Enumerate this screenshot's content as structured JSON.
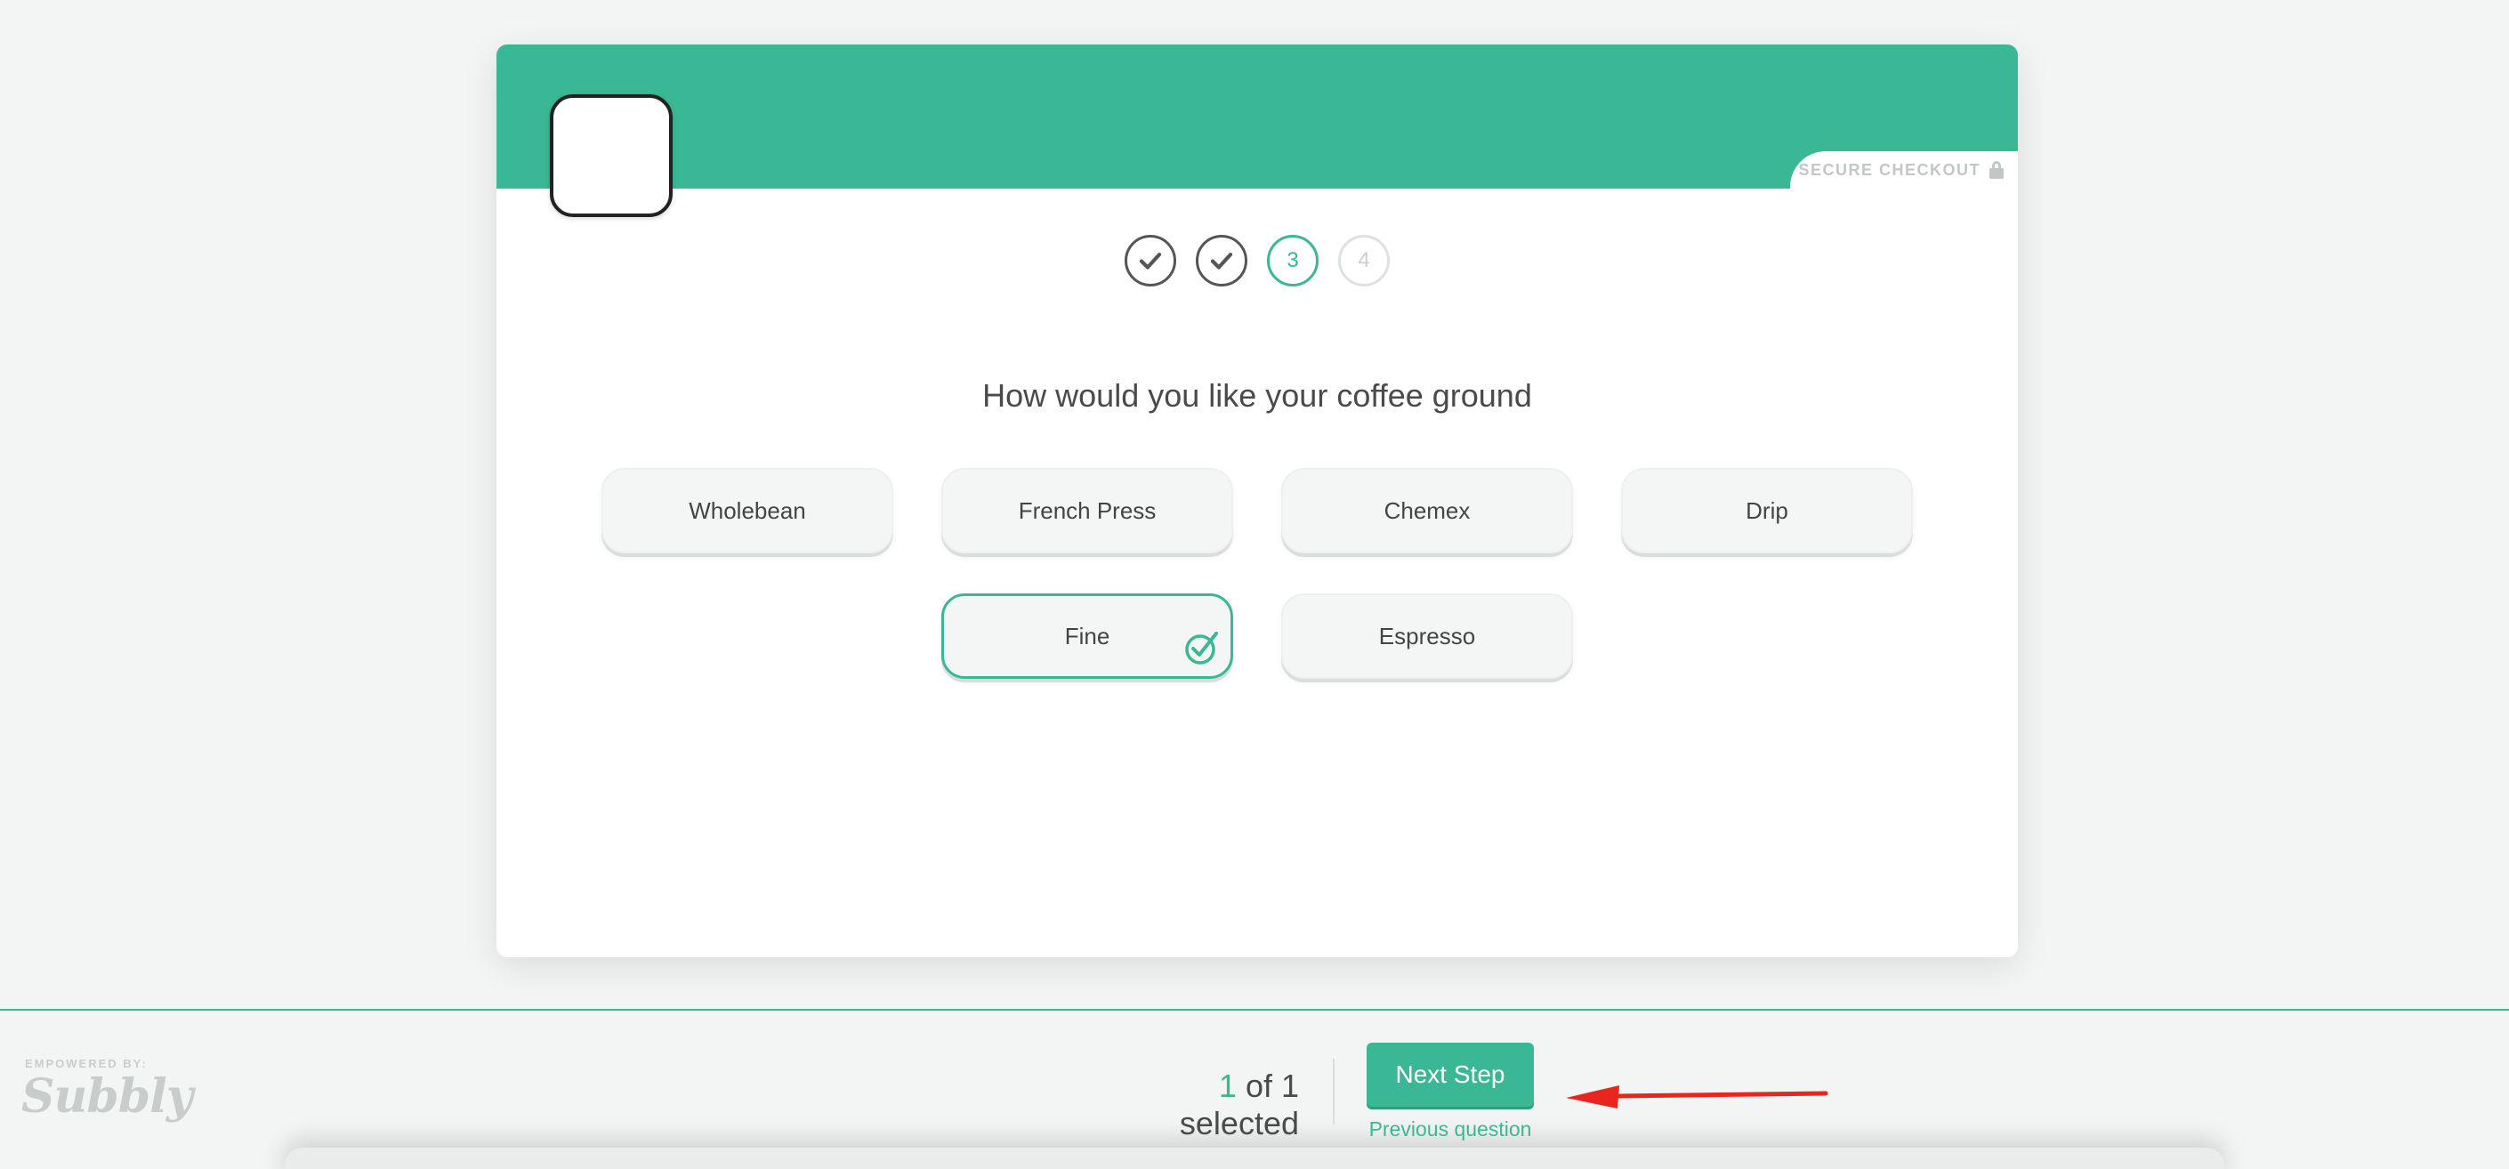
{
  "header": {
    "secure_label": "SECURE CHECKOUT",
    "brand_color": "#3ab795"
  },
  "steps": [
    {
      "state": "done",
      "label": ""
    },
    {
      "state": "done",
      "label": ""
    },
    {
      "state": "current",
      "label": "3"
    },
    {
      "state": "future",
      "label": "4"
    }
  ],
  "question": "How would you like your coffee ground",
  "options": [
    {
      "label": "Wholebean",
      "selected": false
    },
    {
      "label": "French Press",
      "selected": false
    },
    {
      "label": "Chemex",
      "selected": false
    },
    {
      "label": "Drip",
      "selected": false
    },
    {
      "label": "Fine",
      "selected": true
    },
    {
      "label": "Espresso",
      "selected": false
    }
  ],
  "footer": {
    "empowered_by": "EMPOWERED BY:",
    "brand": "Subbly",
    "selected_count": "1",
    "selected_suffix": " of 1 selected",
    "next_label": "Next Step",
    "previous_label": "Previous question"
  },
  "icons": {
    "done_step": "check-icon",
    "selected_option": "check-circle-icon",
    "lock": "lock-icon",
    "annotation": "red-arrow-icon"
  }
}
